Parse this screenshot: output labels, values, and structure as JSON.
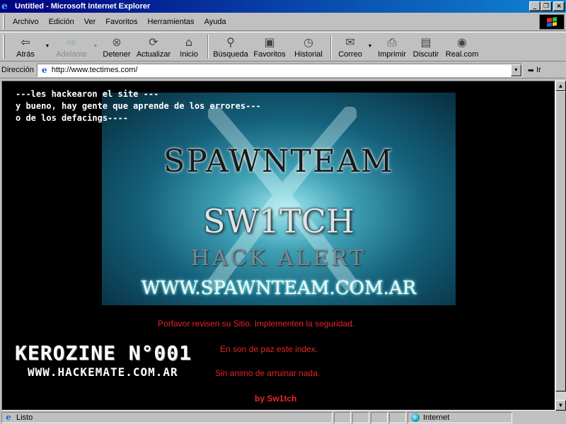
{
  "window": {
    "title": "Untitled - Microsoft Internet Explorer",
    "min_glyph": "_",
    "max_glyph": "❐",
    "close_glyph": "×"
  },
  "menu": [
    "Archivo",
    "Edición",
    "Ver",
    "Favoritos",
    "Herramientas",
    "Ayuda"
  ],
  "toolbar": {
    "back": "Atrás",
    "forward": "Adelante",
    "stop": "Detener",
    "refresh": "Actualizar",
    "home": "Inicio",
    "search": "Búsqueda",
    "favorites": "Favoritos",
    "history": "Historial",
    "mail": "Correo",
    "print": "Imprimir",
    "discuss": "Discutir",
    "realcom": "Real.com"
  },
  "address": {
    "label": "Dirección",
    "url": "http://www.tectimes.com/",
    "go_label": "Ir"
  },
  "page": {
    "intro": "---les hackearon el site ---\ny bueno, hay gente que aprende de los errores---\no de los defacings----",
    "banner": {
      "line1": "SPAWNTEAM",
      "line2": "SW1TCH",
      "line3": "HACK ALERT",
      "line4": "WWW.SPAWNTEAM.COM.AR"
    },
    "message1": "Porfavor revisen su Sitio. Implementen la seguridad.",
    "message2": "En son de paz este index.",
    "message3": "Sin animo de arruinar nada.",
    "signature": "by Sw1tch",
    "logo_title": "KEROZINE N°001",
    "logo_url": "WWW.HACKEMATE.COM.AR"
  },
  "status": {
    "text": "Listo",
    "zone": "Internet"
  },
  "colors": {
    "title_start": "#000080",
    "title_end": "#1084d0",
    "page_bg": "#000000",
    "message_red": "#e8242a",
    "chrome": "#c0c0c0"
  }
}
